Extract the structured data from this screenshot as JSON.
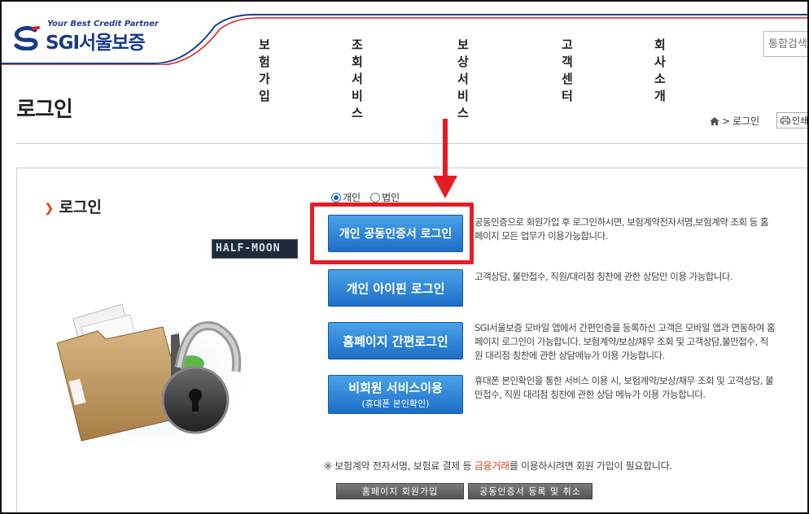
{
  "header": {
    "top_util": "",
    "logo_tagline": "Your Best Credit Partner",
    "logo_sgi": "SGI",
    "logo_name": "서울보증",
    "nav": [
      "보험가입",
      "조회서비스",
      "보상서비스",
      "고객센터",
      "회사소개"
    ],
    "search_placeholder": "통합검색"
  },
  "page": {
    "title": "로그인",
    "breadcrumb_current": "로그인",
    "print_label": "인쇄"
  },
  "login": {
    "section_title": "로그인",
    "radio_individual": "개인",
    "radio_corporate": "법인",
    "watermark": "HALF-MOON",
    "buttons": {
      "cert_login": "개인 공동인증서 로그인",
      "ipin_login": "개인 아이핀 로그인",
      "simple_login": "홈페이지 간편로그인",
      "guest_service": "비회원 서비스이용",
      "guest_service_sub": "(휴대폰 본인확인)"
    },
    "descriptions": {
      "cert_login": "공동인증으로 회원가입 후 로그인하시면, 보험계약전자서명,보험계약 조회 등 홈페이지 모든 업무가 이용가능합니다.",
      "ipin_login": "고객상담, 불만접수, 직원/대리점 칭찬에 관한 상담만 이용 가능합니다.",
      "simple_login": "SGI서울보증 모바일 앱에서 간편인증을 등록하신 고객은 모바일 앱과 연동하여 홈페이지 로그인이 가능합니다. 보험계약/보상/채무 조회 및 고객상담,불만접수, 직원 대리점 칭찬에 관한 상담메뉴가 이용 가능합니다.",
      "guest_service": "휴대폰 본인확인을 통한 서비스 이용 시, 보험계약/보상/채무 조회 및 고객상담, 불만접수, 직원 대리점 칭찬에 관한 상담 메뉴가 이용 가능합니다."
    },
    "notice_prefix": "※ 보험계약 전자서명, 보험료 결제 등 ",
    "notice_emphasis": "금융거래",
    "notice_suffix": "를 이용하시려면 회원 가입이 필요합니다.",
    "join_button": "홈페이지 회원가입",
    "cert_register_button": "공동인증서 등록 및 취소"
  },
  "colors": {
    "brand_blue": "#163a8a",
    "button_blue": "#1c6ec7",
    "highlight_red": "#e41d25",
    "accent_orange": "#e0461c"
  }
}
